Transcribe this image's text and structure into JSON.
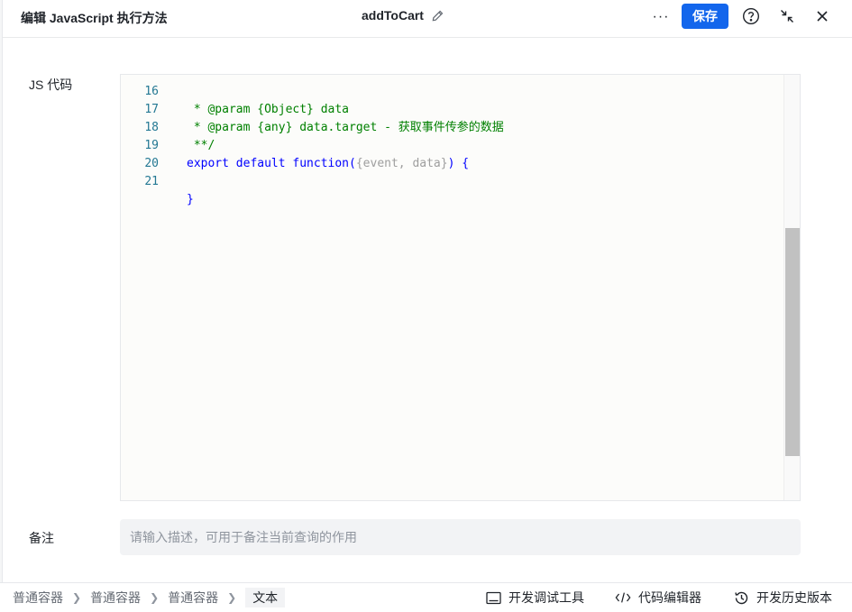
{
  "header": {
    "title": "编辑 JavaScript 执行方法",
    "method_name": "addToCart",
    "more_label": "···",
    "save_label": "保存"
  },
  "form": {
    "js_label": "JS 代码",
    "remark_label": "备注",
    "remark_placeholder": "请输入描述，可用于备注当前查询的作用"
  },
  "editor": {
    "lines": [
      {
        "num": "16",
        "text": " * @param {Object} data"
      },
      {
        "num": "17",
        "text": " * @param {any} data.target - 获取事件传参的数据"
      },
      {
        "num": "18",
        "text": " **/"
      },
      {
        "num": "19",
        "kw": "export default function",
        "open": "(",
        "params": "{event, data}",
        "close": ") {"
      },
      {
        "num": "20",
        "text": ""
      },
      {
        "num": "21",
        "brace": "}"
      }
    ]
  },
  "footer": {
    "breadcrumb": [
      "普通容器",
      "普通容器",
      "普通容器",
      "文本"
    ],
    "devtools_label": "开发调试工具",
    "code_editor_label": "代码编辑器",
    "history_label": "开发历史版本"
  },
  "colors": {
    "primary": "#1366ec",
    "comment": "#008000",
    "keyword": "#0000ff",
    "line_number": "#237893"
  }
}
